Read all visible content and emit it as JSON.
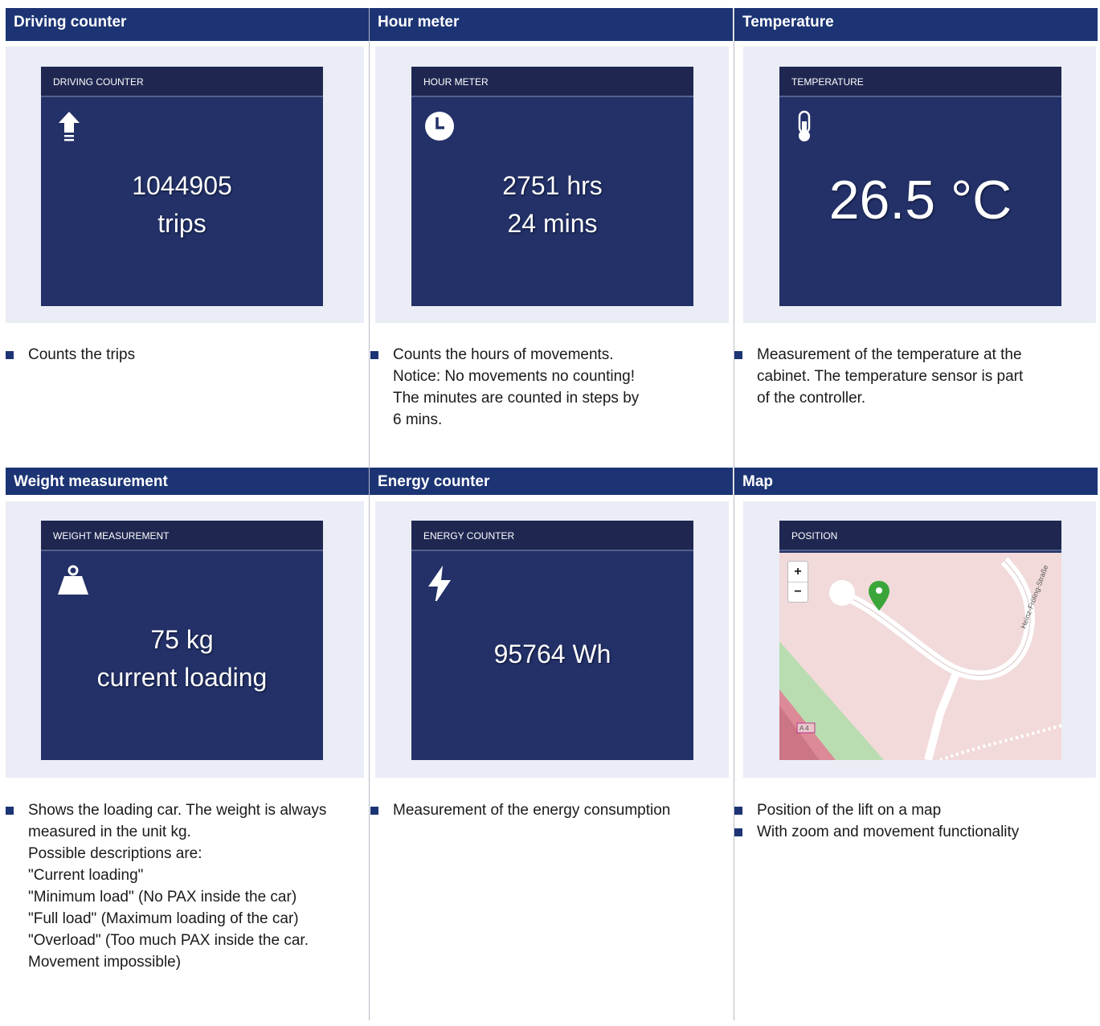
{
  "row1": {
    "headers": [
      "Driving counter",
      "Hour meter",
      "Temperature"
    ],
    "tiles": [
      {
        "title": "DRIVING COUNTER",
        "icon": "arrow-up-icon",
        "value": [
          "1044905",
          "trips"
        ]
      },
      {
        "title": "HOUR METER",
        "icon": "clock-icon",
        "value": [
          "2751 hrs",
          "24 mins"
        ]
      },
      {
        "title": "TEMPERATURE",
        "icon": "thermometer-icon",
        "value": [
          "26.5 °C"
        ]
      }
    ],
    "descriptions": [
      [
        "Counts the trips"
      ],
      [
        "Counts the hours of movements.",
        "Notice: No movements no counting!",
        "The minutes are counted in steps by",
        "6 mins."
      ],
      [
        "Measurement of the temperature at the",
        "cabinet. The temperature sensor is part",
        "of the controller."
      ]
    ]
  },
  "row2": {
    "headers": [
      "Weight measurement",
      "Energy counter",
      "Map"
    ],
    "tiles": [
      {
        "title": "WEIGHT MEASUREMENT",
        "icon": "weight-icon",
        "value": [
          "75 kg",
          "current loading"
        ]
      },
      {
        "title": "ENERGY COUNTER",
        "icon": "lightning-icon",
        "value": [
          "95764 Wh"
        ]
      },
      {
        "title": "POSITION",
        "icon": "map-pin-icon",
        "map": {
          "zoom_in": "+",
          "zoom_out": "−",
          "road_label": "Heinz-Fröling-Straße",
          "highway_label": "A 4"
        }
      }
    ],
    "descriptions": [
      [
        "Shows the loading car. The weight is always",
        "measured in the unit kg.",
        "Possible descriptions are:",
        "\"Current loading\"",
        "\"Minimum load\" (No PAX inside the car)",
        "\"Full load\" (Maximum loading of the car)",
        "\"Overload\" (Too much PAX inside the car.",
        "Movement impossible)"
      ],
      [
        "Measurement of the energy consumption"
      ],
      [
        "Position of the lift on a map"
      ],
      [
        "With zoom and movement functionality"
      ]
    ]
  },
  "colors": {
    "header_bg": "#1c3474",
    "tile_bg": "#233168",
    "tile_header_bg": "#1f2751",
    "panel_bg": "#ebedf6",
    "map_pin": "#3aa63a"
  }
}
